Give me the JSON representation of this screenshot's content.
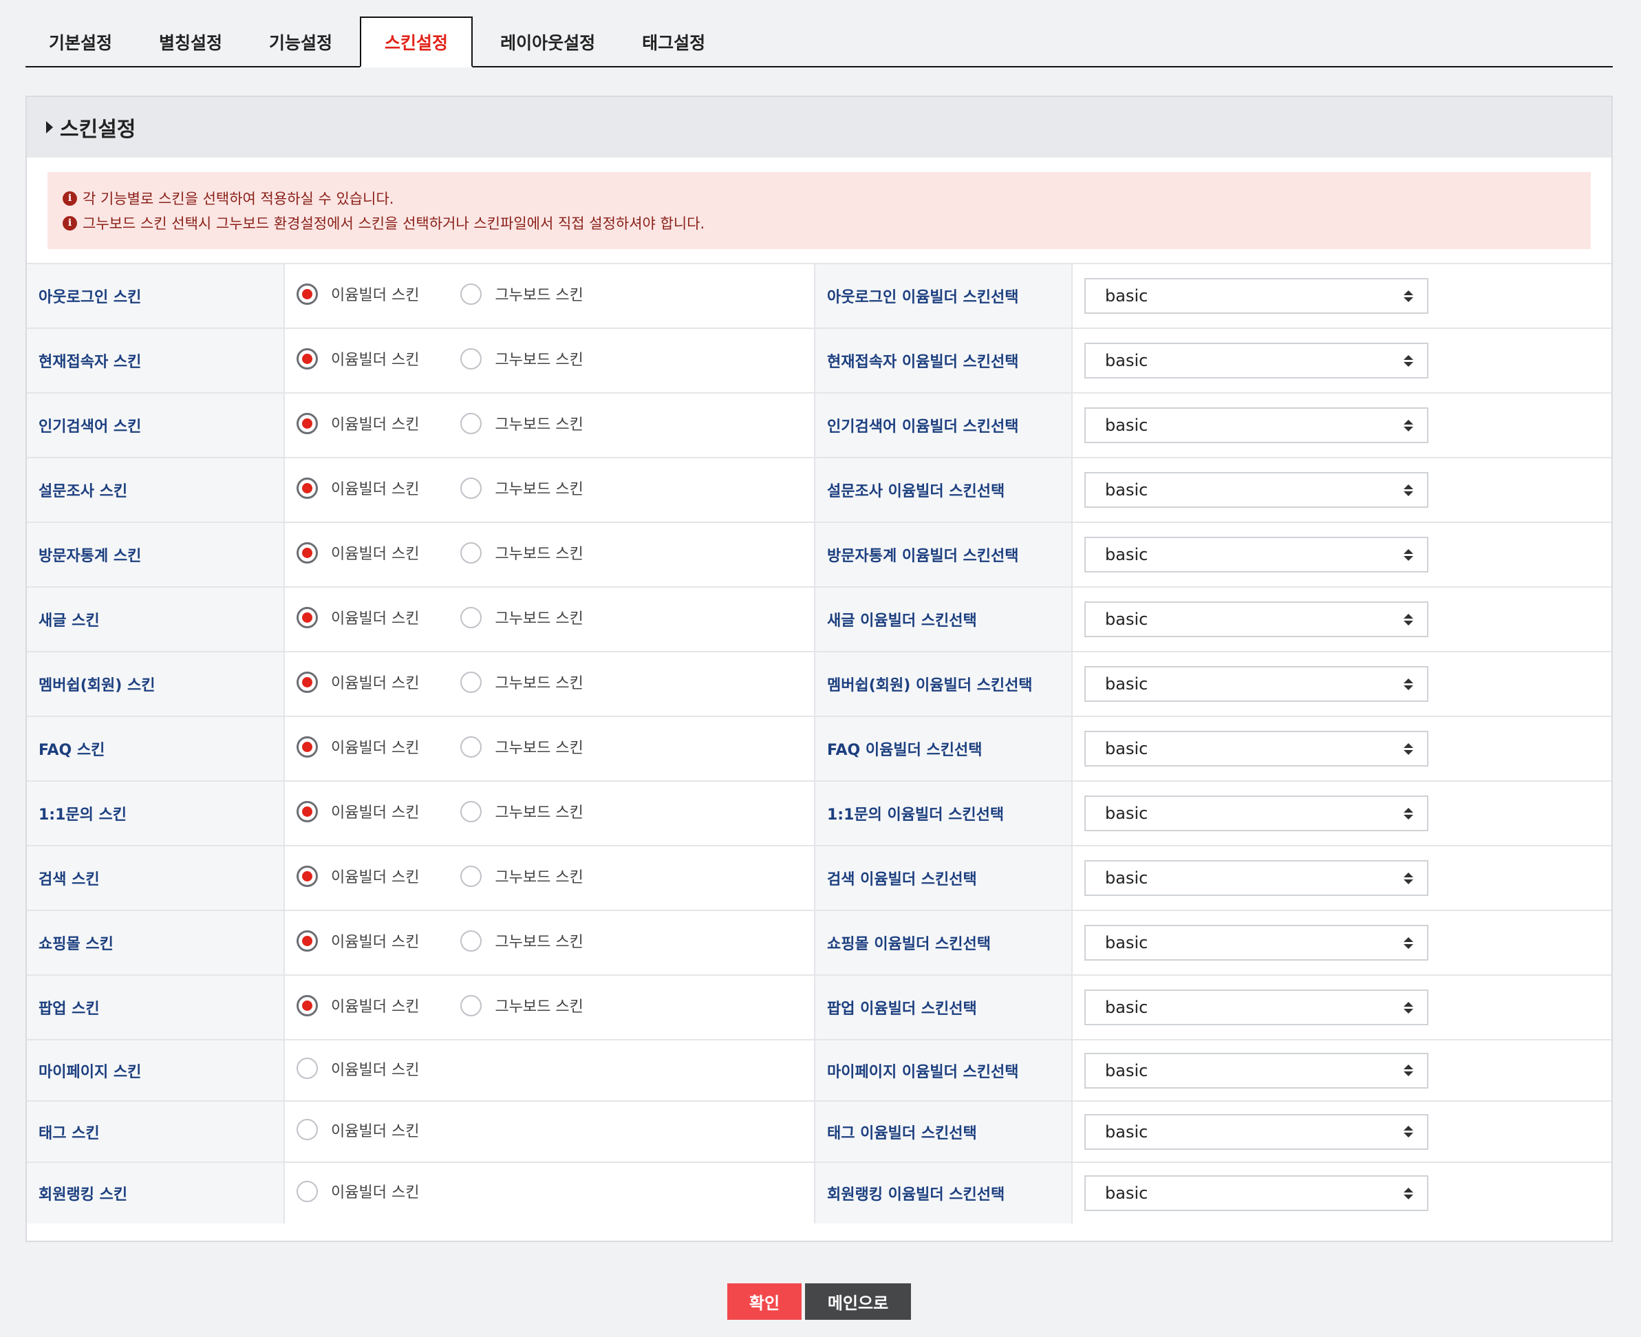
{
  "tabs": [
    {
      "label": "기본설정",
      "active": false
    },
    {
      "label": "별칭설정",
      "active": false
    },
    {
      "label": "기능설정",
      "active": false
    },
    {
      "label": "스킨설정",
      "active": true
    },
    {
      "label": "레이아웃설정",
      "active": false
    },
    {
      "label": "태그설정",
      "active": false
    }
  ],
  "panel": {
    "title": "스킨설정",
    "notices": [
      "각 기능별로 스킨을 선택하여 적용하실 수 있습니다.",
      "그누보드 스킨 선택시 그누보드 환경설정에서 스킨을 선택하거나 스킨파일에서 직접 설정하셔야 합니다."
    ]
  },
  "options": {
    "eyoom": "이윰빌더 스킨",
    "gnu": "그누보드 스킨"
  },
  "rows": [
    {
      "label": "아웃로그인 스킨",
      "select_label": "아웃로그인 이윰빌더 스킨선택",
      "value": "basic",
      "has_gnu": true,
      "selected": "eyoom"
    },
    {
      "label": "현재접속자 스킨",
      "select_label": "현재접속자 이윰빌더 스킨선택",
      "value": "basic",
      "has_gnu": true,
      "selected": "eyoom"
    },
    {
      "label": "인기검색어 스킨",
      "select_label": "인기검색어 이윰빌더 스킨선택",
      "value": "basic",
      "has_gnu": true,
      "selected": "eyoom"
    },
    {
      "label": "설문조사 스킨",
      "select_label": "설문조사 이윰빌더 스킨선택",
      "value": "basic",
      "has_gnu": true,
      "selected": "eyoom"
    },
    {
      "label": "방문자통계 스킨",
      "select_label": "방문자통계 이윰빌더 스킨선택",
      "value": "basic",
      "has_gnu": true,
      "selected": "eyoom"
    },
    {
      "label": "새글 스킨",
      "select_label": "새글 이윰빌더 스킨선택",
      "value": "basic",
      "has_gnu": true,
      "selected": "eyoom"
    },
    {
      "label": "멤버쉽(회원) 스킨",
      "select_label": "멤버쉽(회원) 이윰빌더 스킨선택",
      "value": "basic",
      "has_gnu": true,
      "selected": "eyoom"
    },
    {
      "label": "FAQ 스킨",
      "select_label": "FAQ 이윰빌더 스킨선택",
      "value": "basic",
      "has_gnu": true,
      "selected": "eyoom"
    },
    {
      "label": "1:1문의 스킨",
      "select_label": "1:1문의 이윰빌더 스킨선택",
      "value": "basic",
      "has_gnu": true,
      "selected": "eyoom"
    },
    {
      "label": "검색 스킨",
      "select_label": "검색 이윰빌더 스킨선택",
      "value": "basic",
      "has_gnu": true,
      "selected": "eyoom"
    },
    {
      "label": "쇼핑몰 스킨",
      "select_label": "쇼핑몰 이윰빌더 스킨선택",
      "value": "basic",
      "has_gnu": true,
      "selected": "eyoom"
    },
    {
      "label": "팝업 스킨",
      "select_label": "팝업 이윰빌더 스킨선택",
      "value": "basic",
      "has_gnu": true,
      "selected": "eyoom"
    },
    {
      "label": "마이페이지 스킨",
      "select_label": "마이페이지 이윰빌더 스킨선택",
      "value": "basic",
      "has_gnu": false,
      "selected": "none"
    },
    {
      "label": "태그 스킨",
      "select_label": "태그 이윰빌더 스킨선택",
      "value": "basic",
      "has_gnu": false,
      "selected": "none"
    },
    {
      "label": "회원랭킹 스킨",
      "select_label": "회원랭킹 이윰빌더 스킨선택",
      "value": "basic",
      "has_gnu": false,
      "selected": "none"
    }
  ],
  "buttons": {
    "ok": "확인",
    "main": "메인으로"
  },
  "colors": {
    "accent": "#e2231a",
    "label_blue": "#1c3f7f",
    "notice_bg": "#fbe6e4",
    "ok_button": "#f2484b",
    "main_button": "#464749"
  },
  "icons": {
    "notice": "info-circle-icon",
    "select": "updown-arrows-icon",
    "header": "caret-right-icon"
  }
}
